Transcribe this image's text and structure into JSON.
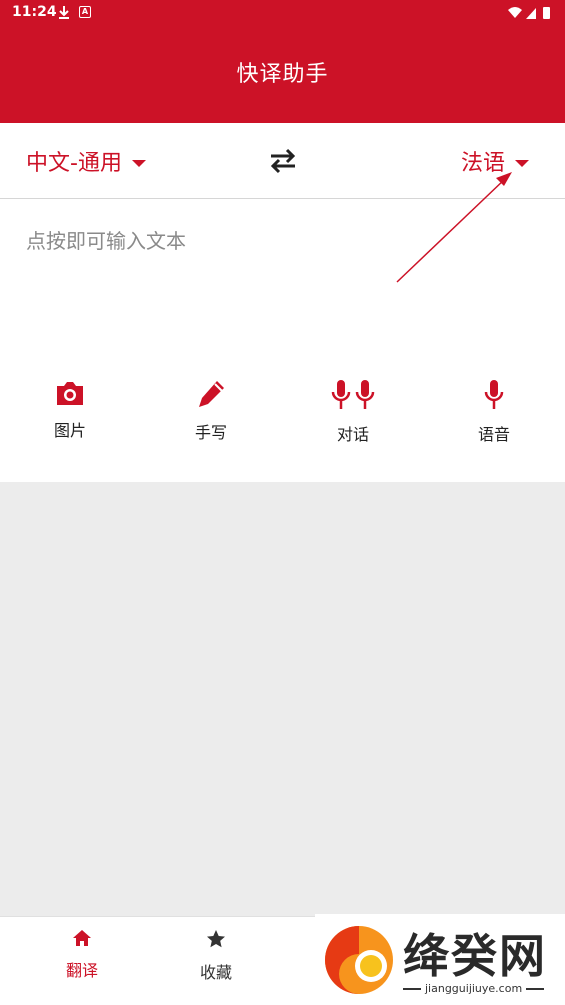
{
  "status_bar": {
    "time": "11:24"
  },
  "header": {
    "title": "快译助手"
  },
  "language_bar": {
    "source_language": "中文-通用",
    "target_language": "法语"
  },
  "input": {
    "placeholder": "点按即可输入文本"
  },
  "tools": [
    {
      "label": "图片",
      "icon": "camera-icon"
    },
    {
      "label": "手写",
      "icon": "pen-icon"
    },
    {
      "label": "对话",
      "icon": "dual-mic-icon"
    },
    {
      "label": "语音",
      "icon": "mic-icon"
    }
  ],
  "bottom_nav": [
    {
      "label": "翻译",
      "icon": "home-icon",
      "active": true
    },
    {
      "label": "收藏",
      "icon": "star-icon",
      "active": false
    }
  ],
  "watermark": {
    "brand": "绛癸网",
    "url": "jiangguijiuye.com"
  },
  "colors": {
    "accent": "#cc1227",
    "background": "#ececec",
    "text": "#222222"
  }
}
